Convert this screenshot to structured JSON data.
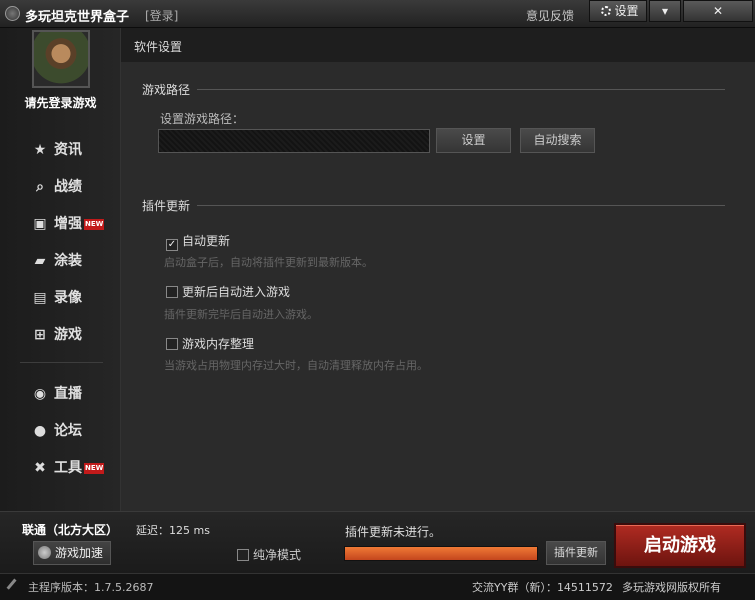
{
  "titlebar": {
    "app_title": "多玩坦克世界盒子",
    "login_link": "[登录]",
    "feedback": "意见反馈",
    "settings": "设置",
    "minimize_icon": "▾",
    "close_icon": "✕"
  },
  "sidebar": {
    "login_prompt": "请先登录游戏",
    "new_badge": "NEW",
    "items": [
      {
        "label": "资讯",
        "icon": "★"
      },
      {
        "label": "战绩",
        "icon": "⌕"
      },
      {
        "label": "增强",
        "icon": "▣"
      },
      {
        "label": "涂装",
        "icon": "▰"
      },
      {
        "label": "录像",
        "icon": "▤"
      },
      {
        "label": "游戏",
        "icon": "⊞"
      },
      {
        "label": "直播",
        "icon": "◉"
      },
      {
        "label": "论坛",
        "icon": "●"
      },
      {
        "label": "工具",
        "icon": "✖"
      }
    ]
  },
  "main": {
    "title": "软件设置",
    "game_path": {
      "section_title": "游戏路径",
      "label": "设置游戏路径：",
      "value": "",
      "set_button": "设置",
      "auto_search_button": "自动搜索"
    },
    "plugin_update": {
      "section_title": "插件更新",
      "options": [
        {
          "label": "自动更新",
          "checked": true,
          "desc": "启动盒子后，自动将插件更新到最新版本。"
        },
        {
          "label": "更新后自动进入游戏",
          "checked": false,
          "desc": "插件更新完毕后自动进入游戏。"
        },
        {
          "label": "游戏内存整理",
          "checked": false,
          "desc": "当游戏占用物理内存过大时，自动清理释放内存占用。"
        }
      ]
    }
  },
  "bottom": {
    "region": "联通（北方大区）",
    "latency": "延迟：125 ms",
    "accelerate_button": "游戏加速",
    "pure_mode": "纯净模式",
    "plugin_status": "插件更新未进行。",
    "progress_percent": 100,
    "plugin_update_button": "插件更新",
    "launch_button": "启动游戏"
  },
  "statusbar": {
    "version": "主程序版本：1.7.5.2687",
    "yy_group": "交流YY群（新）：14511572",
    "copyright": "多玩游戏网版权所有"
  },
  "colors": {
    "accent_orange": "#e06a2c",
    "launch_red": "#9a2219",
    "new_badge_red": "#c21a1a"
  }
}
